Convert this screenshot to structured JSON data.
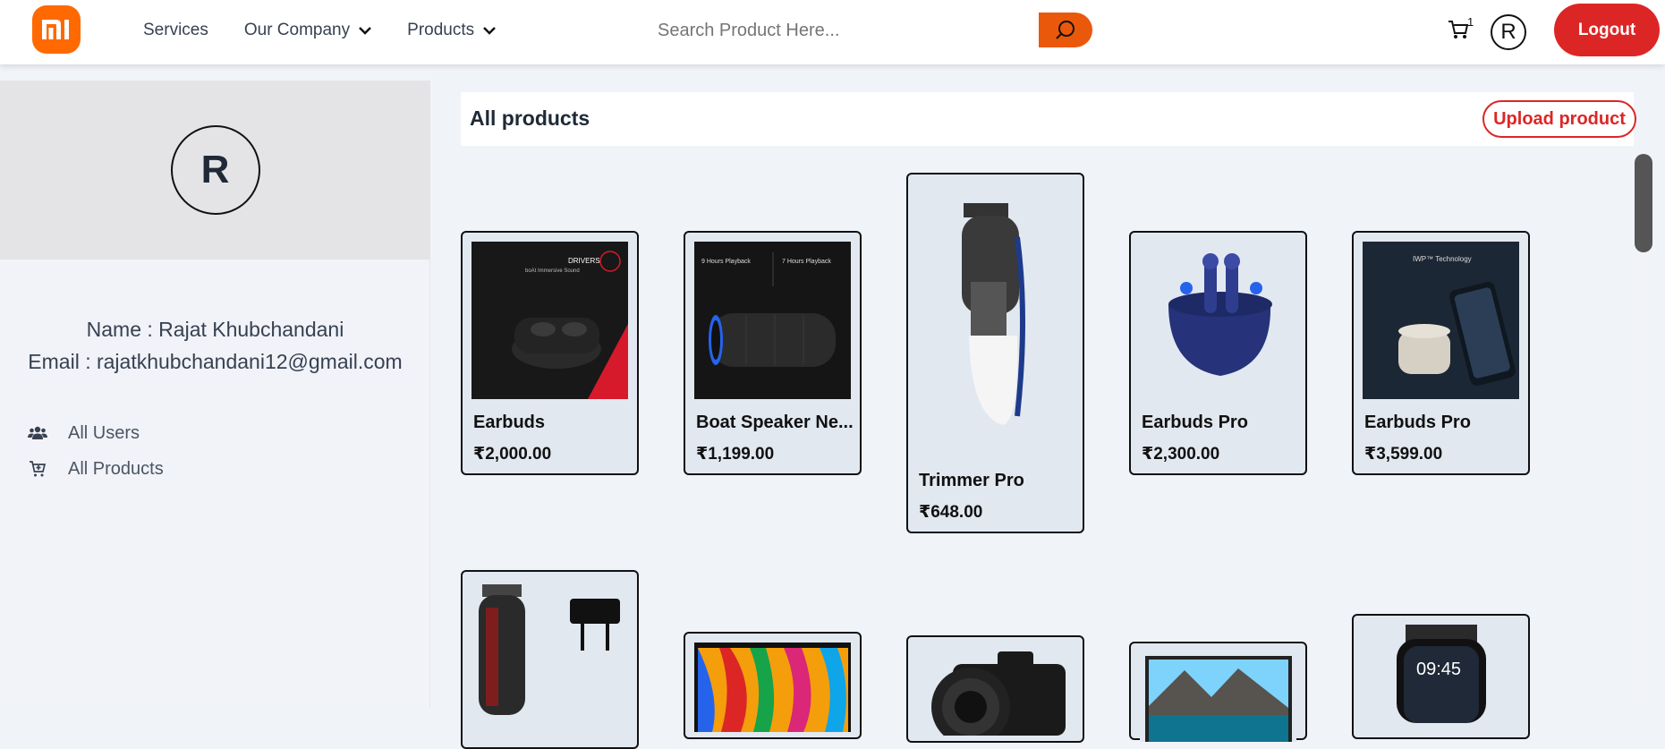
{
  "header": {
    "logo_text": "mi",
    "nav": [
      {
        "label": "Services",
        "has_dropdown": false
      },
      {
        "label": "Our Company",
        "has_dropdown": true
      },
      {
        "label": "Products",
        "has_dropdown": true
      }
    ],
    "search": {
      "placeholder": "Search Product Here..."
    },
    "cart_count": "1",
    "avatar_initial": "R",
    "logout_label": "Logout"
  },
  "sidebar": {
    "avatar_initial": "R",
    "name_line": "Name : Rajat Khubchandani",
    "email_line": "Email : rajatkhubchandani12@gmail.com",
    "links": [
      {
        "label": "All Users",
        "icon": "users-icon"
      },
      {
        "label": "All Products",
        "icon": "cart-icon"
      }
    ]
  },
  "main": {
    "title": "All products",
    "upload_label": "Upload product",
    "products": [
      {
        "name": "Earbuds",
        "price": "₹2,000.00",
        "image": "earbuds-case-image",
        "image_text": "DRIVERS",
        "image_subtext": "boAt Immersive Sound"
      },
      {
        "name": "Boat Speaker Ne...",
        "price": "₹1,199.00",
        "image": "speaker-image",
        "image_text": "9 Hours Playback",
        "image_subtext": "7 Hours Playback"
      },
      {
        "name": "Trimmer Pro",
        "price": "₹648.00",
        "image": "trimmer-image"
      },
      {
        "name": "Earbuds Pro",
        "price": "₹2,300.00",
        "image": "earbuds-pro-image"
      },
      {
        "name": "Earbuds Pro",
        "price": "₹3,599.00",
        "image": "earbuds-phone-image",
        "image_text": "IWP™ Technology"
      },
      {
        "name": "",
        "price": "",
        "image": "beard-trimmer-image"
      },
      {
        "name": "",
        "price": "",
        "image": "tv-image"
      },
      {
        "name": "",
        "price": "",
        "image": "camera-image"
      },
      {
        "name": "",
        "price": "",
        "image": "monitor-image"
      },
      {
        "name": "",
        "price": "",
        "image": "smartwatch-image",
        "image_text": "09:45"
      }
    ]
  },
  "colors": {
    "brand_orange": "#ff6900",
    "search_button": "#ea580c",
    "logout_red": "#dc2626",
    "card_bg": "#e2e8f0"
  }
}
